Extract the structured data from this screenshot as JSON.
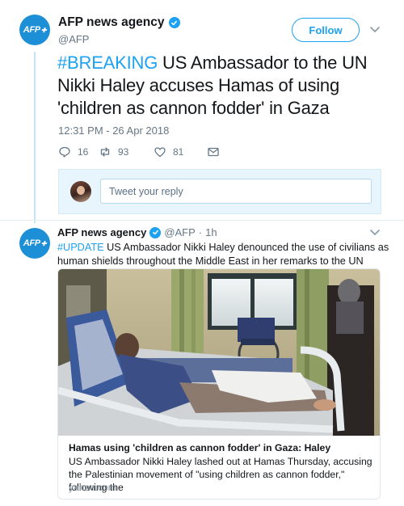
{
  "main_tweet": {
    "avatar_text": "AFP",
    "author_name": "AFP news agency",
    "handle": "@AFP",
    "follow_label": "Follow",
    "hashtag": "#BREAKING",
    "text": " US Ambassador to the UN Nikki Haley accuses Hamas of using 'children as cannon fodder' in Gaza",
    "timestamp": "12:31 PM - 26 Apr 2018",
    "reply_count": "16",
    "retweet_count": "93",
    "like_count": "81",
    "reply_placeholder": "Tweet your reply"
  },
  "quoted_tweet": {
    "avatar_text": "AFP",
    "author_name": "AFP news agency",
    "handle": "@AFP",
    "separator": "·",
    "age": "1h",
    "hashtag": "#UPDATE",
    "text": " US Ambassador Nikki Haley denounced the use of civilians as human shields throughout the Middle East in her remarks to the UN Security Council",
    "card": {
      "title": "Hamas using 'children as cannon fodder' in Gaza: Haley",
      "description": "US Ambassador Nikki Haley lashed out at Hamas Thursday, accusing the Palestinian movement of \"using children as cannon fodder,\" following the",
      "domain": "yahoo.com"
    }
  },
  "icons": [
    "verified-badge-icon",
    "chevron-down-icon",
    "reply-icon",
    "retweet-icon",
    "like-icon",
    "direct-message-icon"
  ],
  "colors": {
    "accent": "#1da1f2",
    "text": "#14171a",
    "secondary": "#657786",
    "reply_box_bg": "#e8f5fd",
    "afp_blue": "#1d8fd6"
  }
}
